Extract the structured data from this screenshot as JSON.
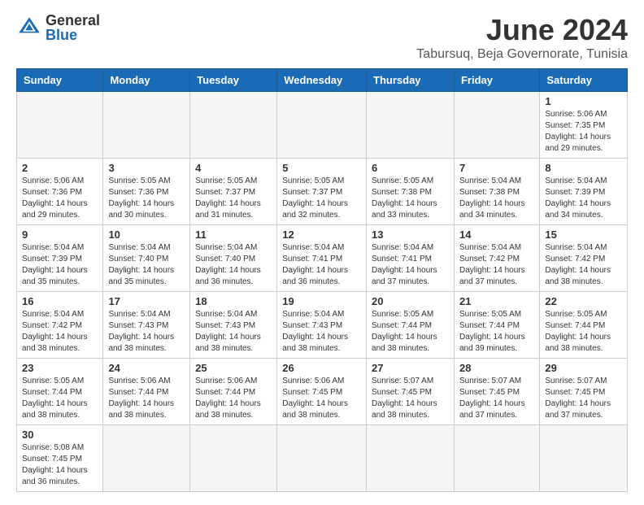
{
  "header": {
    "logo_general": "General",
    "logo_blue": "Blue",
    "month_title": "June 2024",
    "location": "Tabursuq, Beja Governorate, Tunisia"
  },
  "weekdays": [
    "Sunday",
    "Monday",
    "Tuesday",
    "Wednesday",
    "Thursday",
    "Friday",
    "Saturday"
  ],
  "weeks": [
    [
      {
        "day": "",
        "info": ""
      },
      {
        "day": "",
        "info": ""
      },
      {
        "day": "",
        "info": ""
      },
      {
        "day": "",
        "info": ""
      },
      {
        "day": "",
        "info": ""
      },
      {
        "day": "",
        "info": ""
      },
      {
        "day": "1",
        "info": "Sunrise: 5:06 AM\nSunset: 7:35 PM\nDaylight: 14 hours\nand 29 minutes."
      }
    ],
    [
      {
        "day": "2",
        "info": "Sunrise: 5:06 AM\nSunset: 7:36 PM\nDaylight: 14 hours\nand 29 minutes."
      },
      {
        "day": "3",
        "info": "Sunrise: 5:05 AM\nSunset: 7:36 PM\nDaylight: 14 hours\nand 30 minutes."
      },
      {
        "day": "4",
        "info": "Sunrise: 5:05 AM\nSunset: 7:37 PM\nDaylight: 14 hours\nand 31 minutes."
      },
      {
        "day": "5",
        "info": "Sunrise: 5:05 AM\nSunset: 7:37 PM\nDaylight: 14 hours\nand 32 minutes."
      },
      {
        "day": "6",
        "info": "Sunrise: 5:05 AM\nSunset: 7:38 PM\nDaylight: 14 hours\nand 33 minutes."
      },
      {
        "day": "7",
        "info": "Sunrise: 5:04 AM\nSunset: 7:38 PM\nDaylight: 14 hours\nand 34 minutes."
      },
      {
        "day": "8",
        "info": "Sunrise: 5:04 AM\nSunset: 7:39 PM\nDaylight: 14 hours\nand 34 minutes."
      }
    ],
    [
      {
        "day": "9",
        "info": "Sunrise: 5:04 AM\nSunset: 7:39 PM\nDaylight: 14 hours\nand 35 minutes."
      },
      {
        "day": "10",
        "info": "Sunrise: 5:04 AM\nSunset: 7:40 PM\nDaylight: 14 hours\nand 35 minutes."
      },
      {
        "day": "11",
        "info": "Sunrise: 5:04 AM\nSunset: 7:40 PM\nDaylight: 14 hours\nand 36 minutes."
      },
      {
        "day": "12",
        "info": "Sunrise: 5:04 AM\nSunset: 7:41 PM\nDaylight: 14 hours\nand 36 minutes."
      },
      {
        "day": "13",
        "info": "Sunrise: 5:04 AM\nSunset: 7:41 PM\nDaylight: 14 hours\nand 37 minutes."
      },
      {
        "day": "14",
        "info": "Sunrise: 5:04 AM\nSunset: 7:42 PM\nDaylight: 14 hours\nand 37 minutes."
      },
      {
        "day": "15",
        "info": "Sunrise: 5:04 AM\nSunset: 7:42 PM\nDaylight: 14 hours\nand 38 minutes."
      }
    ],
    [
      {
        "day": "16",
        "info": "Sunrise: 5:04 AM\nSunset: 7:42 PM\nDaylight: 14 hours\nand 38 minutes."
      },
      {
        "day": "17",
        "info": "Sunrise: 5:04 AM\nSunset: 7:43 PM\nDaylight: 14 hours\nand 38 minutes."
      },
      {
        "day": "18",
        "info": "Sunrise: 5:04 AM\nSunset: 7:43 PM\nDaylight: 14 hours\nand 38 minutes."
      },
      {
        "day": "19",
        "info": "Sunrise: 5:04 AM\nSunset: 7:43 PM\nDaylight: 14 hours\nand 38 minutes."
      },
      {
        "day": "20",
        "info": "Sunrise: 5:05 AM\nSunset: 7:44 PM\nDaylight: 14 hours\nand 38 minutes."
      },
      {
        "day": "21",
        "info": "Sunrise: 5:05 AM\nSunset: 7:44 PM\nDaylight: 14 hours\nand 39 minutes."
      },
      {
        "day": "22",
        "info": "Sunrise: 5:05 AM\nSunset: 7:44 PM\nDaylight: 14 hours\nand 38 minutes."
      }
    ],
    [
      {
        "day": "23",
        "info": "Sunrise: 5:05 AM\nSunset: 7:44 PM\nDaylight: 14 hours\nand 38 minutes."
      },
      {
        "day": "24",
        "info": "Sunrise: 5:06 AM\nSunset: 7:44 PM\nDaylight: 14 hours\nand 38 minutes."
      },
      {
        "day": "25",
        "info": "Sunrise: 5:06 AM\nSunset: 7:44 PM\nDaylight: 14 hours\nand 38 minutes."
      },
      {
        "day": "26",
        "info": "Sunrise: 5:06 AM\nSunset: 7:45 PM\nDaylight: 14 hours\nand 38 minutes."
      },
      {
        "day": "27",
        "info": "Sunrise: 5:07 AM\nSunset: 7:45 PM\nDaylight: 14 hours\nand 38 minutes."
      },
      {
        "day": "28",
        "info": "Sunrise: 5:07 AM\nSunset: 7:45 PM\nDaylight: 14 hours\nand 37 minutes."
      },
      {
        "day": "29",
        "info": "Sunrise: 5:07 AM\nSunset: 7:45 PM\nDaylight: 14 hours\nand 37 minutes."
      }
    ],
    [
      {
        "day": "30",
        "info": "Sunrise: 5:08 AM\nSunset: 7:45 PM\nDaylight: 14 hours\nand 36 minutes."
      },
      {
        "day": "",
        "info": ""
      },
      {
        "day": "",
        "info": ""
      },
      {
        "day": "",
        "info": ""
      },
      {
        "day": "",
        "info": ""
      },
      {
        "day": "",
        "info": ""
      },
      {
        "day": "",
        "info": ""
      }
    ]
  ]
}
